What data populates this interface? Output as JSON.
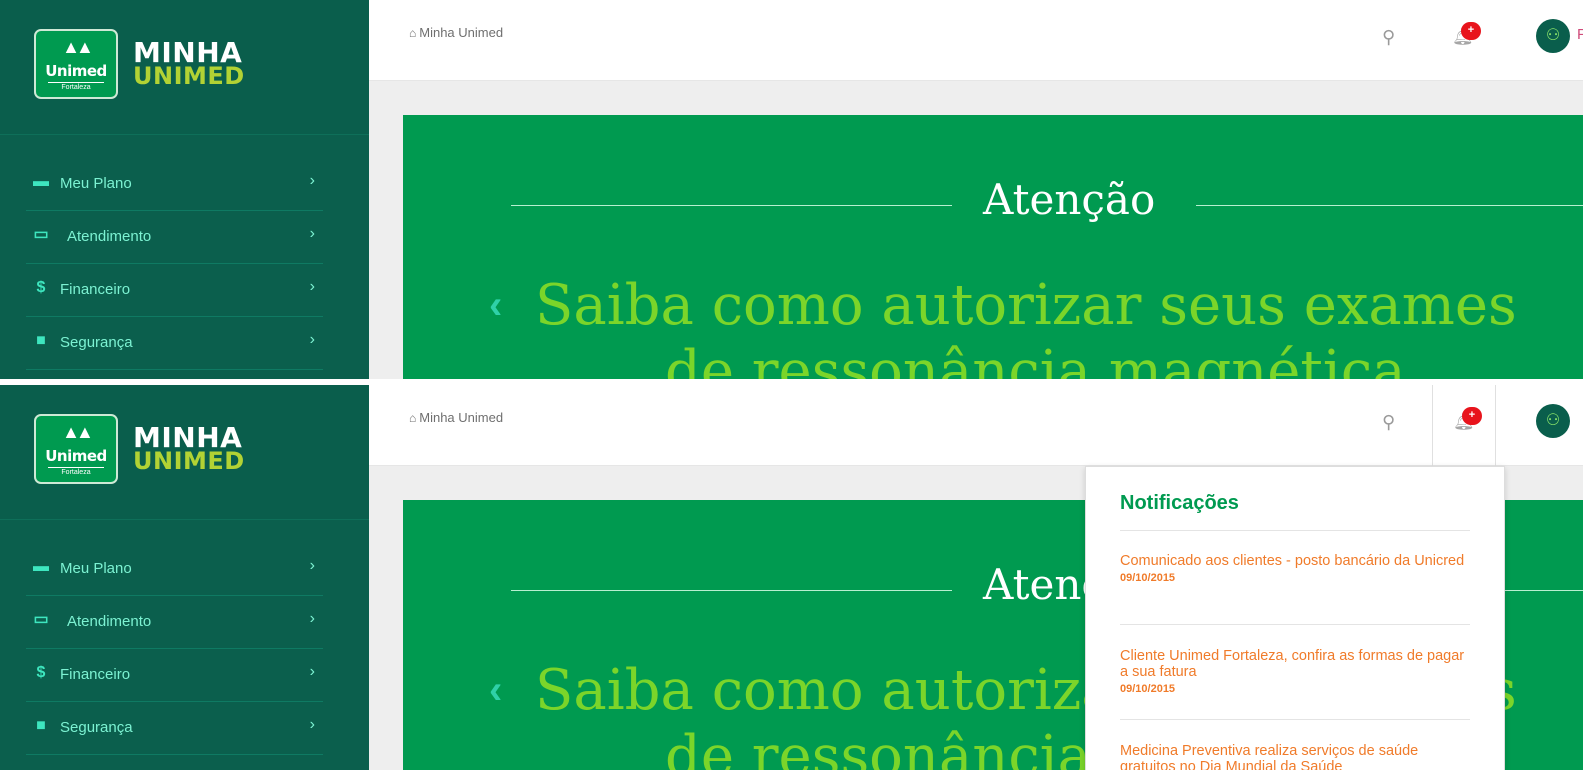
{
  "brand": {
    "logo_name": "Unimed",
    "logo_city": "Fortaleza",
    "title_line1": "MINHA",
    "title_line2": "UNIMED"
  },
  "sidebar": {
    "items": [
      {
        "label": "Meu Plano",
        "icon": "card-icon"
      },
      {
        "label": "Atendimento",
        "icon": "monitor-icon"
      },
      {
        "label": "Financeiro",
        "icon": "dollar-icon"
      },
      {
        "label": "Segurança",
        "icon": "lock-icon"
      }
    ]
  },
  "topbar": {
    "breadcrumb": "Minha Unimed",
    "notification_badge": "+",
    "user_initial": "P"
  },
  "banner": {
    "title": "Atenção",
    "headline_line1": "Saiba como autorizar seus exames",
    "headline_line2": "de ressonância magnética"
  },
  "notifications": {
    "title": "Notificações",
    "items": [
      {
        "text": "Comunicado aos clientes - posto bancário da Unicred",
        "date": "09/10/2015"
      },
      {
        "text": "Cliente Unimed Fortaleza, confira as formas de pagar a sua fatura",
        "date": "09/10/2015"
      },
      {
        "text": "Medicina Preventiva realiza serviços de saúde gratuitos no Dia Mundial da Saúde",
        "date": ""
      }
    ]
  },
  "colors": {
    "sidebar": "#0b5f4d",
    "banner": "#009a50",
    "headline": "#7bd52a",
    "notification_text": "#f07b2a",
    "badge": "#e8141c"
  }
}
